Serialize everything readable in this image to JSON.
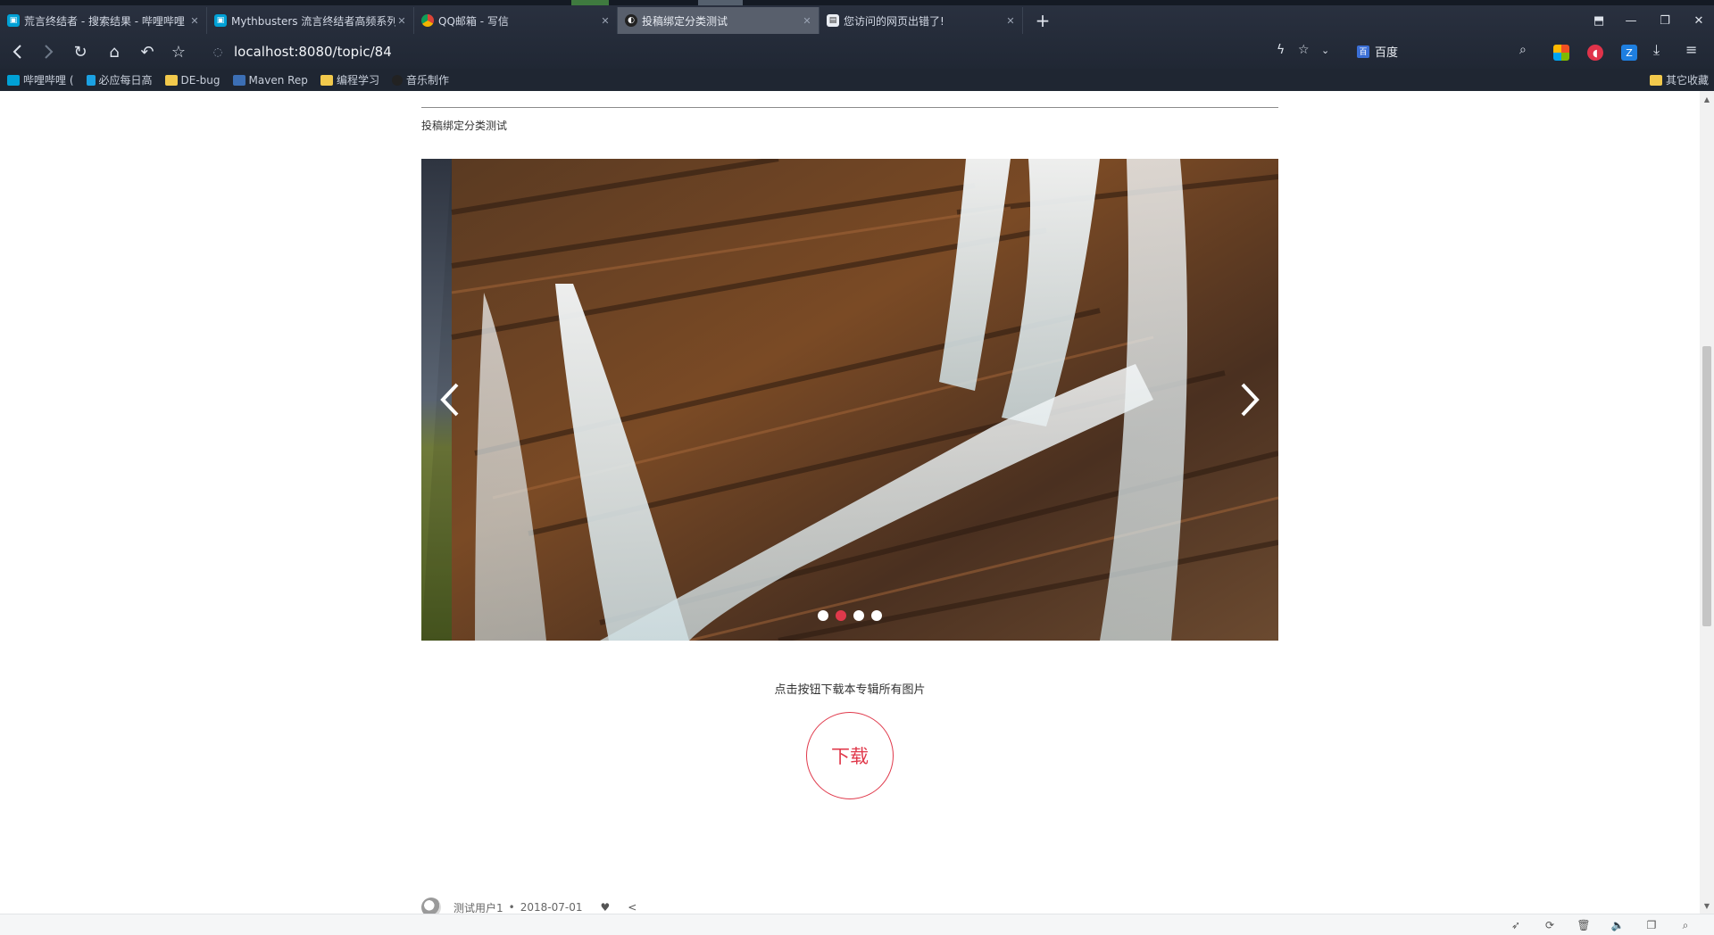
{
  "browser": {
    "tabs": [
      {
        "title": "荒言终结者 - 搜索结果 - 哔哩哔哩",
        "favicon": "bilibili-icon",
        "active": false
      },
      {
        "title": "Mythbusters 流言终结者高频系列",
        "favicon": "bilibili-icon",
        "active": false
      },
      {
        "title": "QQ邮箱 - 写信",
        "favicon": "chrome-icon",
        "active": false
      },
      {
        "title": "投稿绑定分类测试",
        "favicon": "site-icon",
        "active": true
      },
      {
        "title": "您访问的网页出错了!",
        "favicon": "page-icon",
        "active": false
      }
    ],
    "address": {
      "url": "localhost:8080/topic/84"
    },
    "search_engine": "百度",
    "bookmarks": [
      {
        "label": "哔哩哔哩 (",
        "icon": "bilibili-icon"
      },
      {
        "label": "必应每日高",
        "icon": "bing-icon"
      },
      {
        "label": "DE-bug",
        "icon": "folder-icon"
      },
      {
        "label": "Maven Rep",
        "icon": "maven-icon"
      },
      {
        "label": "编程学习",
        "icon": "folder-icon"
      },
      {
        "label": "音乐制作",
        "icon": "music-icon"
      }
    ],
    "bookmarks_right": "其它收藏"
  },
  "page": {
    "category": "投稿绑定分类测试",
    "carousel": {
      "slide_count": 4,
      "active_index": 1
    },
    "download_hint": "点击按钮下载本专辑所有图片",
    "download_label": "下载",
    "author": "测试用户1",
    "date": "2018-07-01"
  },
  "colors": {
    "accent": "#e0394b",
    "chrome": "#2a3140"
  }
}
